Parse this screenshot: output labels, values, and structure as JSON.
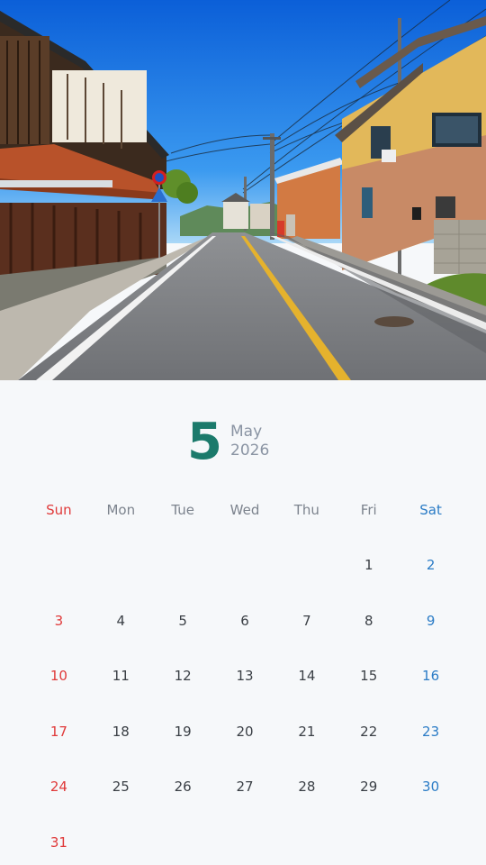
{
  "colors": {
    "accent": "#1b7a6b",
    "sunday": "#e03a3a",
    "saturday": "#2b7cc6"
  },
  "photo": {
    "description_icon": "street-photo"
  },
  "header": {
    "month_number": "5",
    "month_name": "May",
    "year": "2026"
  },
  "weekdays": [
    "Sun",
    "Mon",
    "Tue",
    "Wed",
    "Thu",
    "Fri",
    "Sat"
  ],
  "weeks": [
    [
      "",
      "",
      "",
      "",
      "",
      "1",
      "2"
    ],
    [
      "3",
      "4",
      "5",
      "6",
      "7",
      "8",
      "9"
    ],
    [
      "10",
      "11",
      "12",
      "13",
      "14",
      "15",
      "16"
    ],
    [
      "17",
      "18",
      "19",
      "20",
      "21",
      "22",
      "23"
    ],
    [
      "24",
      "25",
      "26",
      "27",
      "28",
      "29",
      "30"
    ],
    [
      "31",
      "",
      "",
      "",
      "",
      "",
      ""
    ]
  ]
}
